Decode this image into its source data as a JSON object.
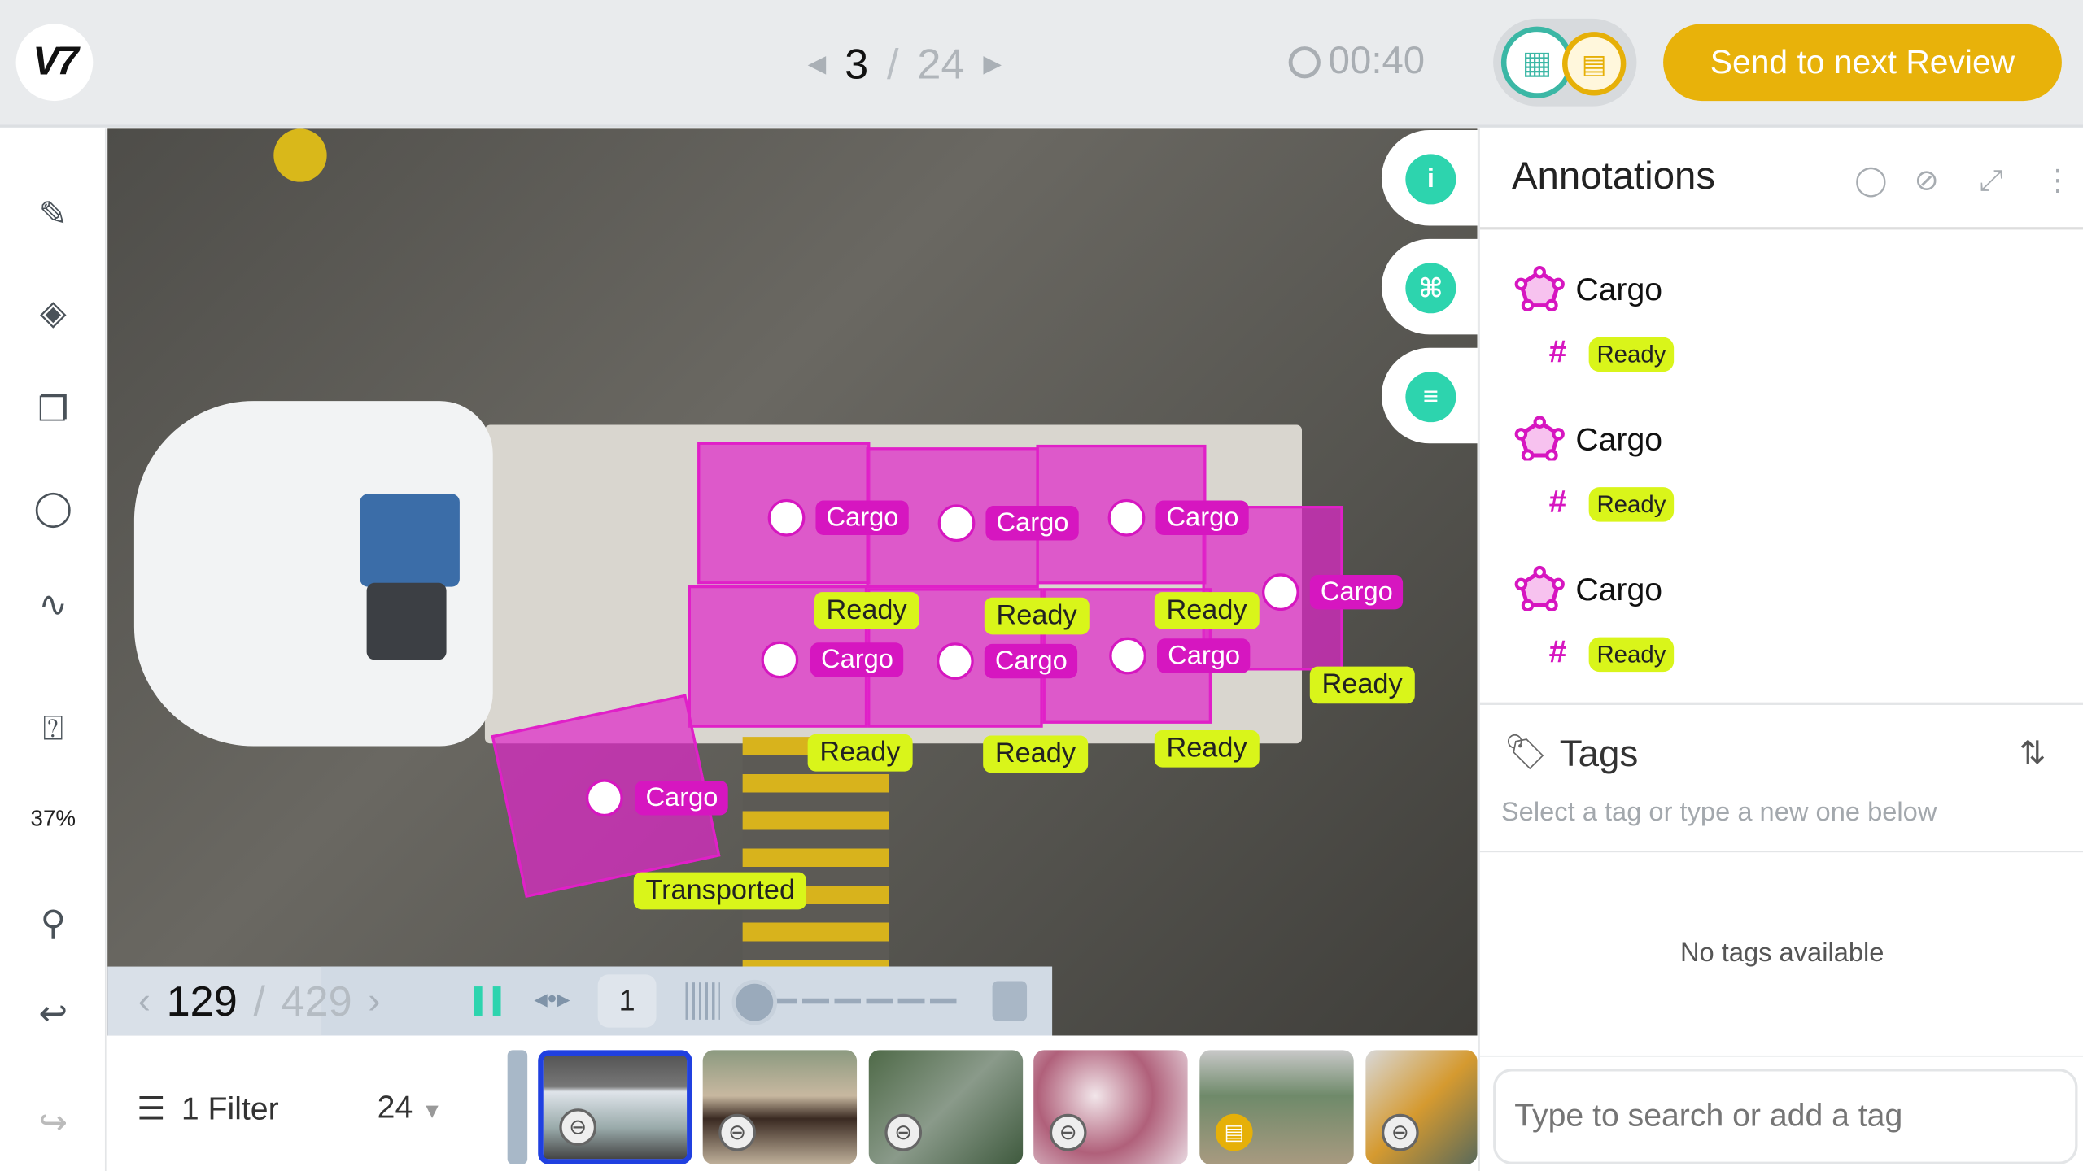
{
  "header": {
    "logo": "V7",
    "current_item": "3",
    "separator": "/",
    "total_items": "24",
    "timer": "00:40",
    "send_button": "Send to next Review",
    "stage_icons": [
      "stage-grid-icon",
      "stage-review-icon"
    ]
  },
  "toolbar": {
    "zoom_level": "37%",
    "tools": [
      "polygon-tool-icon",
      "brush-tool-icon",
      "clone-icon",
      "ellipse-icon",
      "path-icon",
      "comment-icon",
      "auto-annotate-icon",
      "undo-icon",
      "redo-icon"
    ]
  },
  "canvas": {
    "cargo_labels": [
      "Cargo",
      "Cargo",
      "Cargo",
      "Cargo",
      "Cargo",
      "Cargo",
      "Cargo",
      "Cargo"
    ],
    "tag_labels": [
      "Ready",
      "Ready",
      "Ready",
      "Ready",
      "Ready",
      "Ready",
      "Ready",
      "Transported"
    ],
    "colors": {
      "cargo": "#d616c0",
      "tag": "#d9f51a"
    }
  },
  "floating_buttons": [
    "info-icon",
    "command-icon",
    "settings-sliders-icon"
  ],
  "playback": {
    "frame": "129",
    "separator": "/",
    "total_frames": "429",
    "step": "1"
  },
  "annotations": {
    "title": "Annotations",
    "items": [
      {
        "class": "Cargo",
        "tag": "Ready"
      },
      {
        "class": "Cargo",
        "tag": "Ready"
      },
      {
        "class": "Cargo",
        "tag": "Ready"
      }
    ]
  },
  "tags": {
    "title": "Tags",
    "hint": "Select a tag or type a new one below",
    "empty": "No tags available",
    "input_placeholder": "Type to search or add a tag"
  },
  "filmstrip": {
    "filter_label": "1 Filter",
    "count": "24"
  }
}
